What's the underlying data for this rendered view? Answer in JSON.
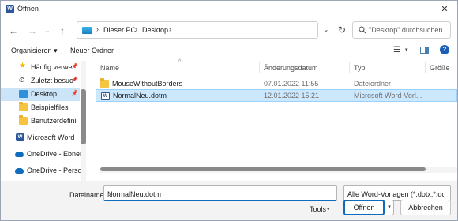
{
  "window": {
    "title": "Öffnen",
    "app_icon": "word-icon"
  },
  "address": {
    "crumbs": [
      "Dieser PC",
      "Desktop"
    ]
  },
  "search": {
    "placeholder": "\"Desktop\" durchsuchen"
  },
  "toolbar": {
    "organize": "Organisieren ▾",
    "new_folder": "Neuer Ordner"
  },
  "nav": {
    "items": [
      {
        "label": "Häufig verwe",
        "icon": "star-icon"
      },
      {
        "label": "Zuletzt besuc",
        "icon": "clock-icon"
      },
      {
        "label": "Desktop",
        "icon": "desktop-icon"
      },
      {
        "label": "Beispielfiles",
        "icon": "folder-icon"
      },
      {
        "label": "Benutzerdefini",
        "icon": "folder-icon"
      },
      {
        "label": "Microsoft Word",
        "icon": "word-icon"
      },
      {
        "label": "OneDrive - Ebner",
        "icon": "cloud-icon"
      },
      {
        "label": "OneDrive - Persor",
        "icon": "cloud-icon"
      }
    ]
  },
  "columns": {
    "name": "Name",
    "date": "Änderungsdatum",
    "type": "Typ",
    "size": "Größe"
  },
  "files": [
    {
      "name": "MouseWithoutBorders",
      "date": "07.01.2022 11:55",
      "type": "Dateiordner",
      "icon": "folder-icon"
    },
    {
      "name": "NormalNeu.dotm",
      "date": "12.01.2022 15:21",
      "type": "Microsoft Word-Vorl...",
      "icon": "word-template-icon"
    }
  ],
  "footer": {
    "filename_label": "Dateiname:",
    "filename_value": "NormalNeu.dotm",
    "filter_value": "Alle Word-Vorlagen (*.dotx;*.do",
    "tools_label": "Tools",
    "open_label": "Öffnen",
    "cancel_label": "Abbrechen"
  },
  "colors": {
    "accent": "#0f6cbd",
    "selection": "#cce8ff"
  }
}
